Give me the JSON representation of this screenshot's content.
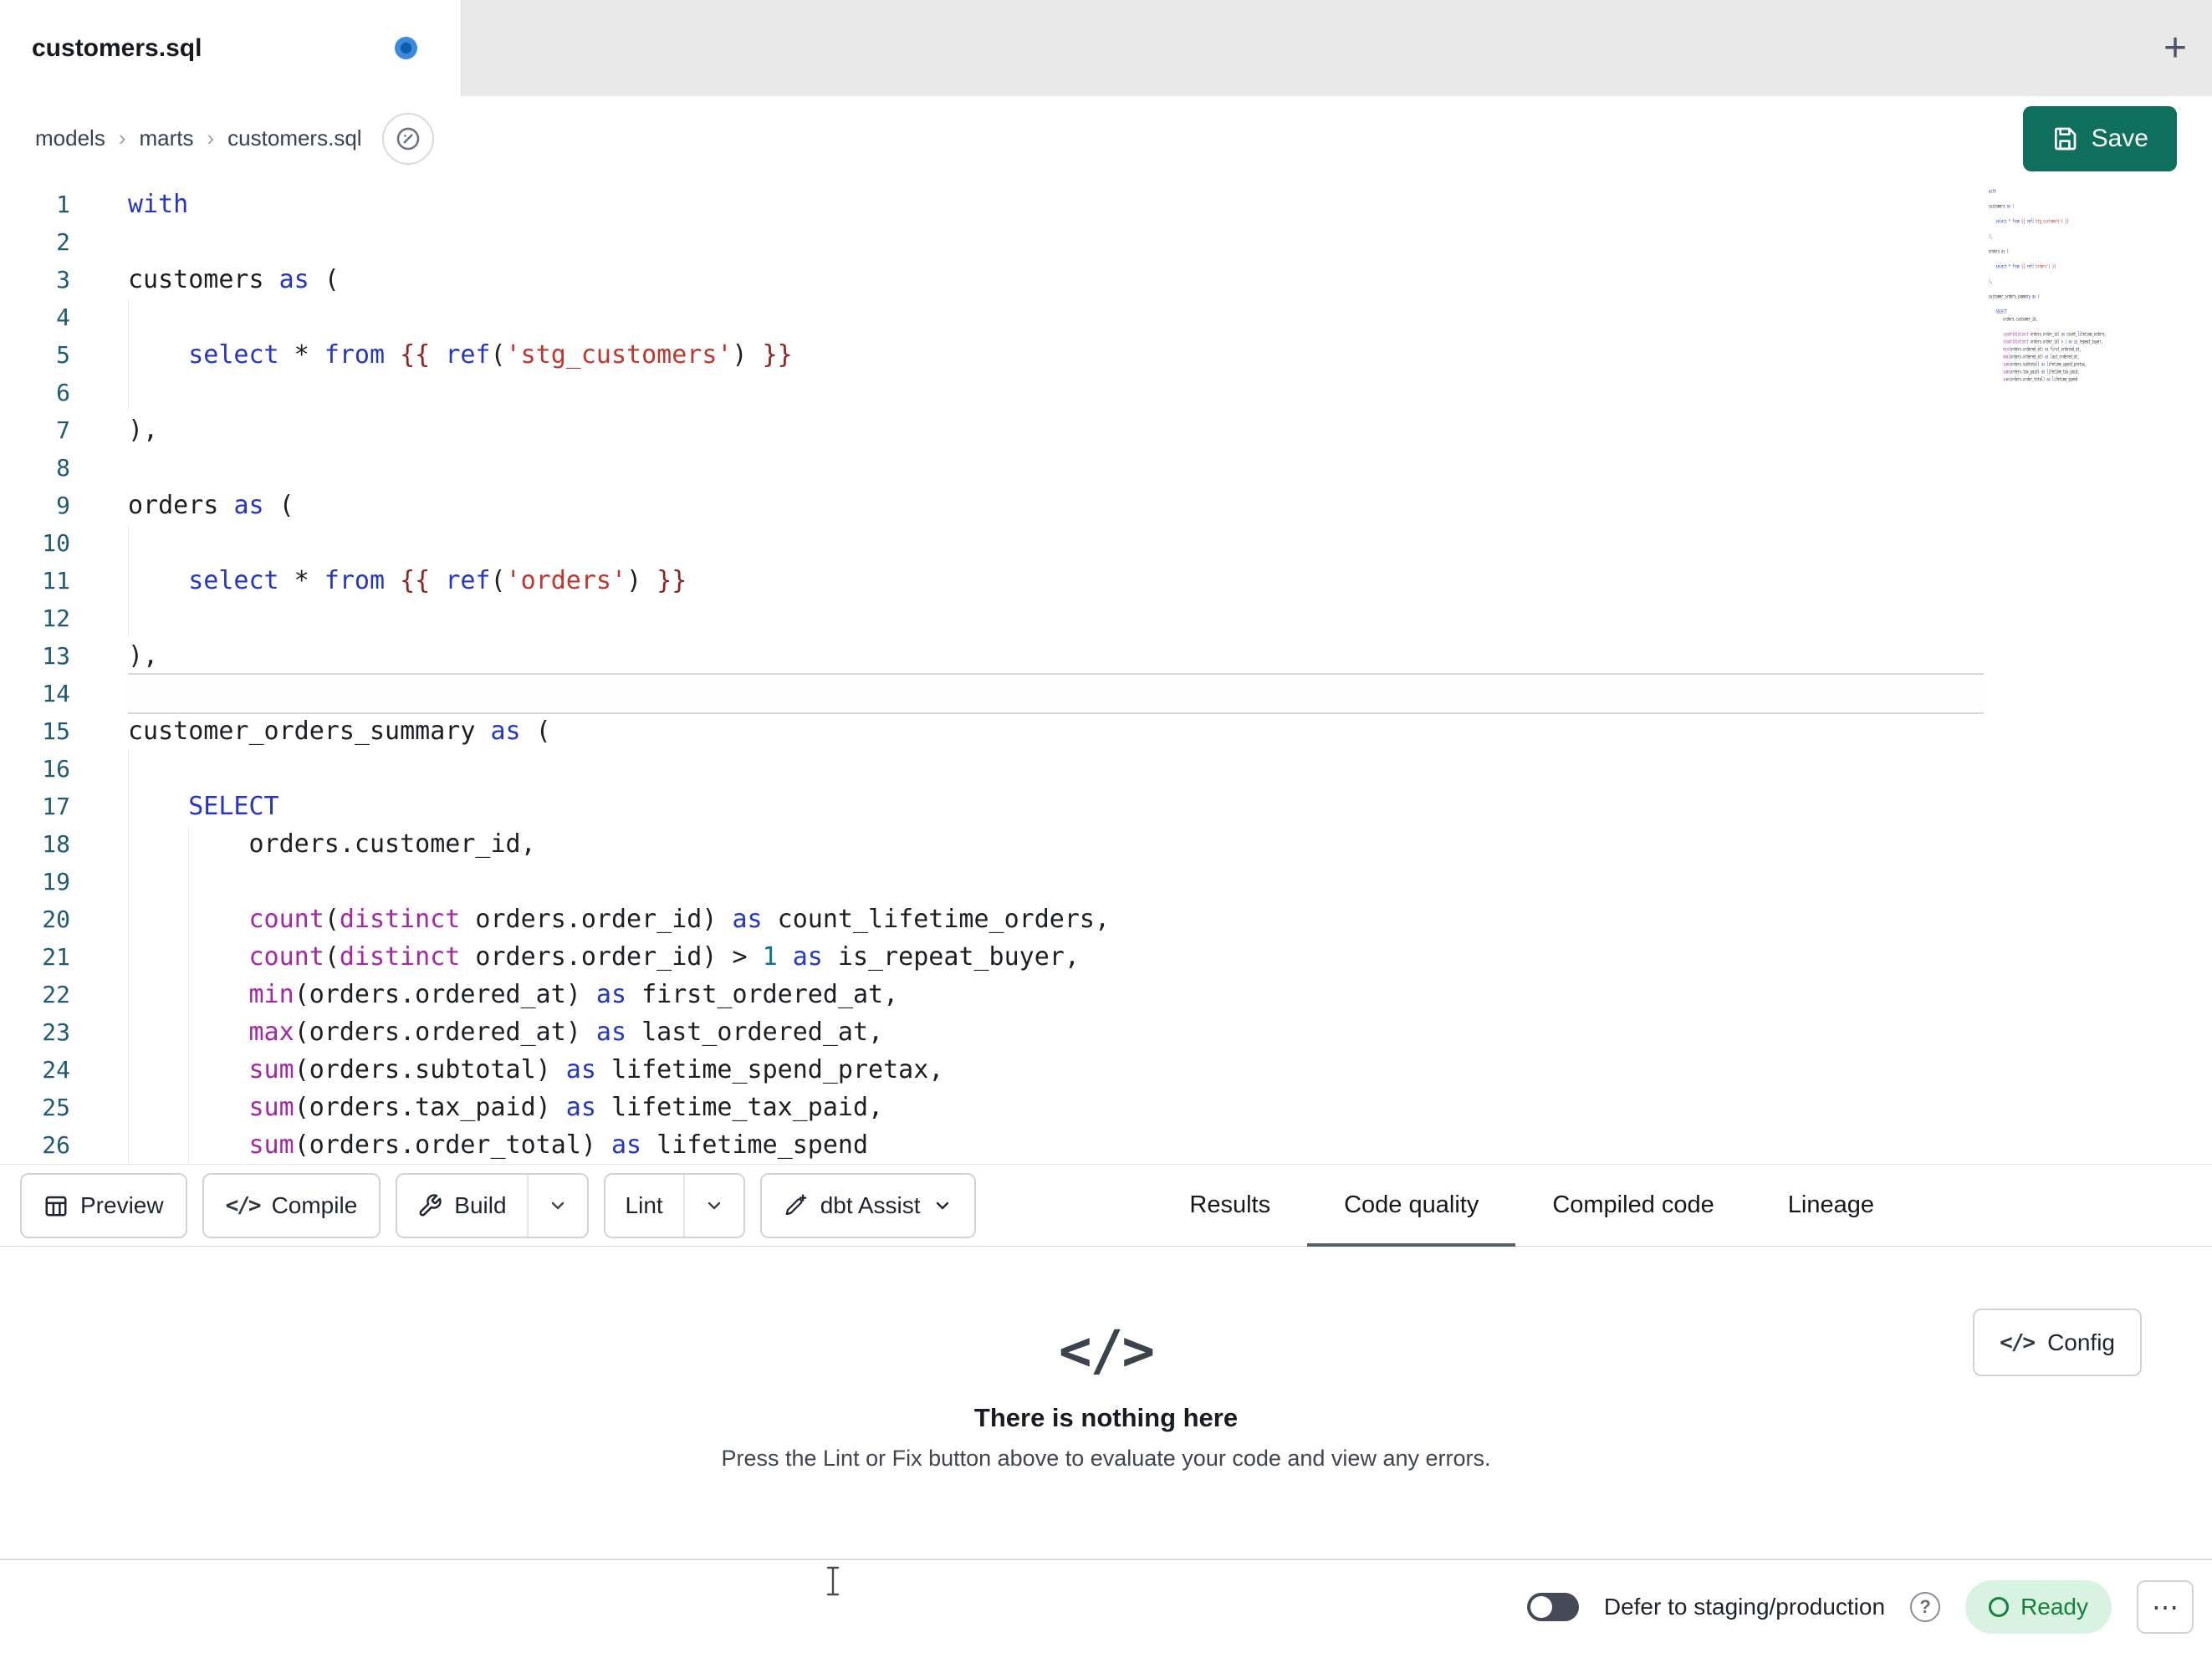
{
  "colors": {
    "kw": "#2336c4",
    "fn": "#a626a4",
    "str": "#c0362c",
    "num": "#0e7490",
    "jj": "#8f2323",
    "pl": "#1b1f23",
    "ln": "#1f5c73",
    "save": "#0e705c",
    "ready_bg": "#d9f3e3",
    "ready_text": "#15803d"
  },
  "tab_bar": {
    "active_tab": "customers.sql",
    "new_tab": "+"
  },
  "breadcrumb": {
    "items": [
      "models",
      "marts",
      "customers.sql"
    ],
    "separator": "›"
  },
  "save": {
    "label": "Save"
  },
  "icons": {
    "code_glyph": "</>"
  },
  "editor": {
    "lines": [
      {
        "n": "1",
        "g": [],
        "t": [
          [
            "kw",
            "with"
          ]
        ]
      },
      {
        "n": "2",
        "g": [],
        "t": []
      },
      {
        "n": "3",
        "g": [],
        "t": [
          [
            "pl",
            "customers "
          ],
          [
            "kw",
            "as"
          ],
          [
            "pl",
            " ("
          ]
        ]
      },
      {
        "n": "4",
        "g": [
          0
        ],
        "t": []
      },
      {
        "n": "5",
        "g": [
          0
        ],
        "t": [
          [
            "pl",
            "    "
          ],
          [
            "kw",
            "select"
          ],
          [
            "pl",
            " * "
          ],
          [
            "kw",
            "from"
          ],
          [
            "pl",
            " "
          ],
          [
            "jj",
            "{{"
          ],
          [
            "pl",
            " "
          ],
          [
            "kw",
            "ref"
          ],
          [
            "pl",
            "("
          ],
          [
            "str",
            "'stg_customers'"
          ],
          [
            "pl",
            ") "
          ],
          [
            "jj",
            "}}"
          ]
        ]
      },
      {
        "n": "6",
        "g": [
          0
        ],
        "t": []
      },
      {
        "n": "7",
        "g": [],
        "t": [
          [
            "pl",
            "),"
          ]
        ]
      },
      {
        "n": "8",
        "g": [],
        "t": []
      },
      {
        "n": "9",
        "g": [],
        "t": [
          [
            "pl",
            "orders "
          ],
          [
            "kw",
            "as"
          ],
          [
            "pl",
            " ("
          ]
        ]
      },
      {
        "n": "10",
        "g": [
          0
        ],
        "t": []
      },
      {
        "n": "11",
        "g": [
          0
        ],
        "t": [
          [
            "pl",
            "    "
          ],
          [
            "kw",
            "select"
          ],
          [
            "pl",
            " * "
          ],
          [
            "kw",
            "from"
          ],
          [
            "pl",
            " "
          ],
          [
            "jj",
            "{{"
          ],
          [
            "pl",
            " "
          ],
          [
            "kw",
            "ref"
          ],
          [
            "pl",
            "("
          ],
          [
            "str",
            "'orders'"
          ],
          [
            "pl",
            ") "
          ],
          [
            "jj",
            "}}"
          ]
        ]
      },
      {
        "n": "12",
        "g": [
          0
        ],
        "t": []
      },
      {
        "n": "13",
        "g": [],
        "t": [
          [
            "pl",
            "),"
          ]
        ]
      },
      {
        "n": "14",
        "g": [],
        "cur": true,
        "t": []
      },
      {
        "n": "15",
        "g": [],
        "t": [
          [
            "pl",
            "customer_orders_summary "
          ],
          [
            "kw",
            "as"
          ],
          [
            "pl",
            " ("
          ]
        ]
      },
      {
        "n": "16",
        "g": [
          0
        ],
        "t": []
      },
      {
        "n": "17",
        "g": [
          0
        ],
        "t": [
          [
            "pl",
            "    "
          ],
          [
            "kw",
            "SELECT"
          ]
        ]
      },
      {
        "n": "18",
        "g": [
          0,
          4
        ],
        "t": [
          [
            "pl",
            "        orders.customer_id,"
          ]
        ]
      },
      {
        "n": "19",
        "g": [
          0,
          4
        ],
        "t": []
      },
      {
        "n": "20",
        "g": [
          0,
          4
        ],
        "t": [
          [
            "pl",
            "        "
          ],
          [
            "fn",
            "count"
          ],
          [
            "pl",
            "("
          ],
          [
            "fn",
            "distinct"
          ],
          [
            "pl",
            " orders.order_id) "
          ],
          [
            "kw",
            "as"
          ],
          [
            "pl",
            " count_lifetime_orders,"
          ]
        ]
      },
      {
        "n": "21",
        "g": [
          0,
          4
        ],
        "t": [
          [
            "pl",
            "        "
          ],
          [
            "fn",
            "count"
          ],
          [
            "pl",
            "("
          ],
          [
            "fn",
            "distinct"
          ],
          [
            "pl",
            " orders.order_id) > "
          ],
          [
            "num",
            "1"
          ],
          [
            "pl",
            " "
          ],
          [
            "kw",
            "as"
          ],
          [
            "pl",
            " is_repeat_buyer,"
          ]
        ]
      },
      {
        "n": "22",
        "g": [
          0,
          4
        ],
        "t": [
          [
            "pl",
            "        "
          ],
          [
            "fn",
            "min"
          ],
          [
            "pl",
            "(orders.ordered_at) "
          ],
          [
            "kw",
            "as"
          ],
          [
            "pl",
            " first_ordered_at,"
          ]
        ]
      },
      {
        "n": "23",
        "g": [
          0,
          4
        ],
        "t": [
          [
            "pl",
            "        "
          ],
          [
            "fn",
            "max"
          ],
          [
            "pl",
            "(orders.ordered_at) "
          ],
          [
            "kw",
            "as"
          ],
          [
            "pl",
            " last_ordered_at,"
          ]
        ]
      },
      {
        "n": "24",
        "g": [
          0,
          4
        ],
        "t": [
          [
            "pl",
            "        "
          ],
          [
            "fn",
            "sum"
          ],
          [
            "pl",
            "(orders.subtotal) "
          ],
          [
            "kw",
            "as"
          ],
          [
            "pl",
            " lifetime_spend_pretax,"
          ]
        ]
      },
      {
        "n": "25",
        "g": [
          0,
          4
        ],
        "t": [
          [
            "pl",
            "        "
          ],
          [
            "fn",
            "sum"
          ],
          [
            "pl",
            "(orders.tax_paid) "
          ],
          [
            "kw",
            "as"
          ],
          [
            "pl",
            " lifetime_tax_paid,"
          ]
        ]
      },
      {
        "n": "26",
        "g": [
          0,
          4
        ],
        "t": [
          [
            "pl",
            "        "
          ],
          [
            "fn",
            "sum"
          ],
          [
            "pl",
            "(orders.order_total) "
          ],
          [
            "kw",
            "as"
          ],
          [
            "pl",
            " lifetime_spend"
          ]
        ]
      }
    ]
  },
  "toolbar": {
    "preview_label": "Preview",
    "compile_label": "Compile",
    "build_label": "Build",
    "lint_label": "Lint",
    "assist_label": "dbt Assist"
  },
  "result_tabs": [
    {
      "label": "Results",
      "active": false
    },
    {
      "label": "Code quality",
      "active": true
    },
    {
      "label": "Compiled code",
      "active": false
    },
    {
      "label": "Lineage",
      "active": false
    }
  ],
  "results_panel": {
    "config_label": "Config",
    "empty_title": "There is nothing here",
    "empty_subtitle": "Press the Lint or Fix button above to evaluate your code and view any errors."
  },
  "status_bar": {
    "defer_label": "Defer to staging/production",
    "help_glyph": "?",
    "ready_label": "Ready",
    "more_glyph": "⋯"
  }
}
